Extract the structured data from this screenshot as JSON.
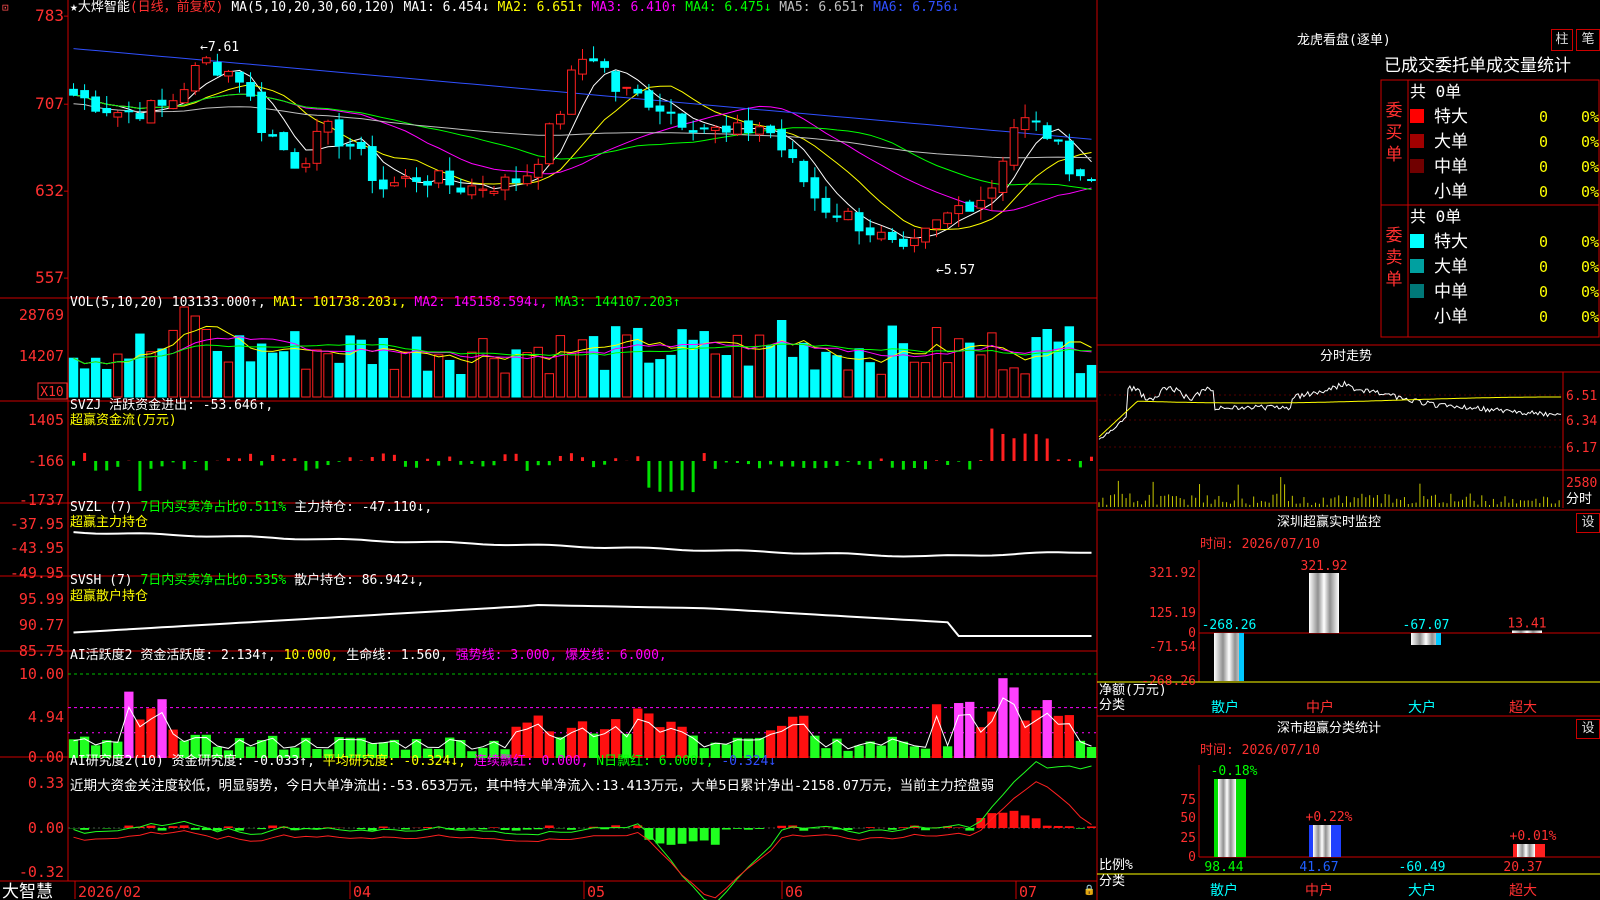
{
  "main_header": {
    "star": "★",
    "name": "大烨智能",
    "mode": "(日线，前复权)",
    "ma_params": "MA(5,10,20,30,60,120)",
    "items": [
      {
        "text": "MA1: 6.454↓",
        "color": "#ffffff"
      },
      {
        "text": "MA2: 6.651↑",
        "color": "#ffff00"
      },
      {
        "text": "MA3: 6.410↑",
        "color": "#ff00ff"
      },
      {
        "text": "MA4: 6.475↓",
        "color": "#00ff00"
      },
      {
        "text": "MA5: 6.651↑",
        "color": "#c0c0c0"
      },
      {
        "text": "MA6: 6.756↓",
        "color": "#3050ff"
      }
    ],
    "corner": "⊡"
  },
  "price_axis": [
    "783",
    "707",
    "632",
    "557"
  ],
  "price_annotations": {
    "high": "7.61",
    "low": "←5.57"
  },
  "vol_header": {
    "params": "VOL(5,10,20)",
    "value": "103133.000↑,",
    "items": [
      {
        "text": "MA1: 101738.203↓,",
        "color": "#ffff00"
      },
      {
        "text": "MA2: 145158.594↓,",
        "color": "#ff00ff"
      },
      {
        "text": "MA3: 144107.203↑",
        "color": "#00ff00"
      }
    ]
  },
  "vol_axis": [
    "28769",
    "14207"
  ],
  "vol_unit": "X10",
  "svzj_header": {
    "name": "SVZJ",
    "label": "活跃资金进出: -53.646↑,",
    "sub": "超赢资金流(万元)"
  },
  "svzj_axis": [
    "1405",
    "-166",
    "-1737"
  ],
  "svzl_header": {
    "name": "SVZL (7)",
    "ratio": "7日内买卖净占比0.511%",
    "holding": "主力持仓: -47.110↓,",
    "sub": "超赢主力持仓"
  },
  "svzl_axis": [
    "-37.95",
    "-43.95",
    "-49.95"
  ],
  "svsh_header": {
    "name": "SVSH (7)",
    "ratio": "7日内买卖净占比0.535%",
    "holding": "散户持仓: 86.942↓,",
    "sub": "超赢散户持仓"
  },
  "svsh_axis": [
    "95.99",
    "90.77",
    "85.75"
  ],
  "ai2_header": {
    "name": "AI活跃度2",
    "items": [
      {
        "text": "资金活跃度: 2.134↑,",
        "color": "#ffffff"
      },
      {
        "text": "10.000,",
        "color": "#ffff00"
      },
      {
        "text": "生命线: 1.560,",
        "color": "#ffffff"
      },
      {
        "text": "强势线: 3.000,",
        "color": "#ff00ff"
      },
      {
        "text": "爆发线: 6.000,",
        "color": "#ff00ff"
      }
    ]
  },
  "ai2_axis": [
    "10.00",
    "4.94",
    "0.00"
  ],
  "ai_research_header": {
    "name": "AI研究度2(10)",
    "items": [
      {
        "text": "资金研究度: -0.033↑,",
        "color": "#ffffff"
      },
      {
        "text": "平均研究度: -0.324↓,",
        "color": "#ffff00"
      },
      {
        "text": "连续飘红: 0.000,",
        "color": "#ff00ff"
      },
      {
        "text": "N日飘红: 6.000↓,",
        "color": "#00ff00"
      },
      {
        "text": "-0.324↓",
        "color": "#3050ff"
      }
    ],
    "comment": "近期大资金关注度较低，明显弱势，今日大单净流出:-53.653万元，其中特大单净流入:13.413万元，大单5日累计净出-2158.07万元，当前主力控盘弱"
  },
  "ai_research_axis": [
    "0.33",
    "0.00",
    "-0.32"
  ],
  "x_axis": {
    "brand": "大智慧",
    "labels": [
      "2026/02",
      "04",
      "05",
      "06",
      "07"
    ]
  },
  "right": {
    "title": "龙虎看盘(逐单)",
    "btn_zhu": "柱",
    "btn_bi": "笔",
    "section_title": "已成交委托单成交量统计",
    "buy": {
      "side": "委买单",
      "total": "共 0单",
      "rows": [
        {
          "label": "特大",
          "value": "0",
          "pct": "0%",
          "color": "#ff0000"
        },
        {
          "label": "大单",
          "value": "0",
          "pct": "0%",
          "color": "#a00000"
        },
        {
          "label": "中单",
          "value": "0",
          "pct": "0%",
          "color": "#700000"
        },
        {
          "label": "小单",
          "value": "0",
          "pct": "0%",
          "color": "#000000"
        }
      ]
    },
    "sell": {
      "side": "委卖单",
      "total": "共 0单",
      "rows": [
        {
          "label": "特大",
          "value": "0",
          "pct": "0%",
          "color": "#00ffff"
        },
        {
          "label": "大单",
          "value": "0",
          "pct": "0%",
          "color": "#00a0a0"
        },
        {
          "label": "中单",
          "value": "0",
          "pct": "0%",
          "color": "#007878"
        },
        {
          "label": "小单",
          "value": "0",
          "pct": "0%",
          "color": "#000000"
        }
      ]
    },
    "intraday": {
      "title": "分时走势",
      "axis": [
        "6.51",
        "6.34",
        "6.17"
      ],
      "vol_label": "2580",
      "vol_unit": "分时"
    },
    "monitor": {
      "title": "深圳超赢实时监控",
      "btn": "设",
      "time": "时间: 2026/07/10",
      "axis": [
        "321.92",
        "125.19",
        "0",
        "-71.54",
        "-268.26"
      ],
      "ylabel": "净额(万元)",
      "xlabel": "分类",
      "categories": [
        "散户",
        "中户",
        "大户",
        "超大"
      ],
      "values": [
        "-268.26",
        "321.92",
        "-67.07",
        "13.41"
      ]
    },
    "classify": {
      "title": "深市超赢分类统计",
      "btn": "设",
      "time": "时间: 2026/07/10",
      "axis": [
        "75",
        "50",
        "25",
        "0"
      ],
      "ylabel": "比例%",
      "xlabel": "分类",
      "categories": [
        "散户",
        "中户",
        "大户",
        "超大"
      ],
      "top_labels": [
        "-0.18%",
        "+0.22%",
        "",
        "+0.01%"
      ],
      "values": [
        "98.44",
        "41.67",
        "-60.49",
        "20.37"
      ]
    }
  },
  "chart_data": [
    {
      "type": "candlestick",
      "series": [
        {
          "name": "大烨智能",
          "values": "generated"
        }
      ],
      "ylim": [
        5.45,
        7.9
      ],
      "annotations": {
        "high": 7.61,
        "low": 5.57
      },
      "ma": {
        "MA1": 6.454,
        "MA2": 6.651,
        "MA3": 6.41,
        "MA4": 6.475,
        "MA5": 6.651,
        "MA6": 6.756
      }
    },
    {
      "type": "bar",
      "ylim": [
        0,
        300000
      ],
      "last": 103133.0,
      "ma": {
        "MA1": 101738.203,
        "MA2": 145158.594,
        "MA3": 144107.203
      }
    },
    {
      "type": "bar",
      "ylim": [
        -1737,
        1405
      ],
      "last": -53.646
    },
    {
      "type": "line",
      "ylim": [
        -49.95,
        -37.95
      ],
      "last": -47.11
    },
    {
      "type": "line",
      "ylim": [
        85.75,
        95.99
      ],
      "last": 86.942
    },
    {
      "type": "bar",
      "ylim": [
        0,
        10
      ],
      "last": 2.134,
      "lines": {
        "生命线": 1.56,
        "强势线": 3.0,
        "爆发线": 6.0
      }
    },
    {
      "type": "bar",
      "ylim": [
        -0.32,
        0.33
      ],
      "last": -0.033,
      "avg": -0.324
    },
    {
      "type": "bar",
      "categories": [
        "散户",
        "中户",
        "大户",
        "超大"
      ],
      "values": [
        -268.26,
        321.92,
        -67.07,
        13.41
      ],
      "ylim": [
        -268.26,
        321.92
      ]
    },
    {
      "type": "bar",
      "categories": [
        "散户",
        "中户",
        "大户",
        "超大"
      ],
      "values": [
        98.44,
        41.67,
        -60.49,
        20.37
      ]
    }
  ]
}
